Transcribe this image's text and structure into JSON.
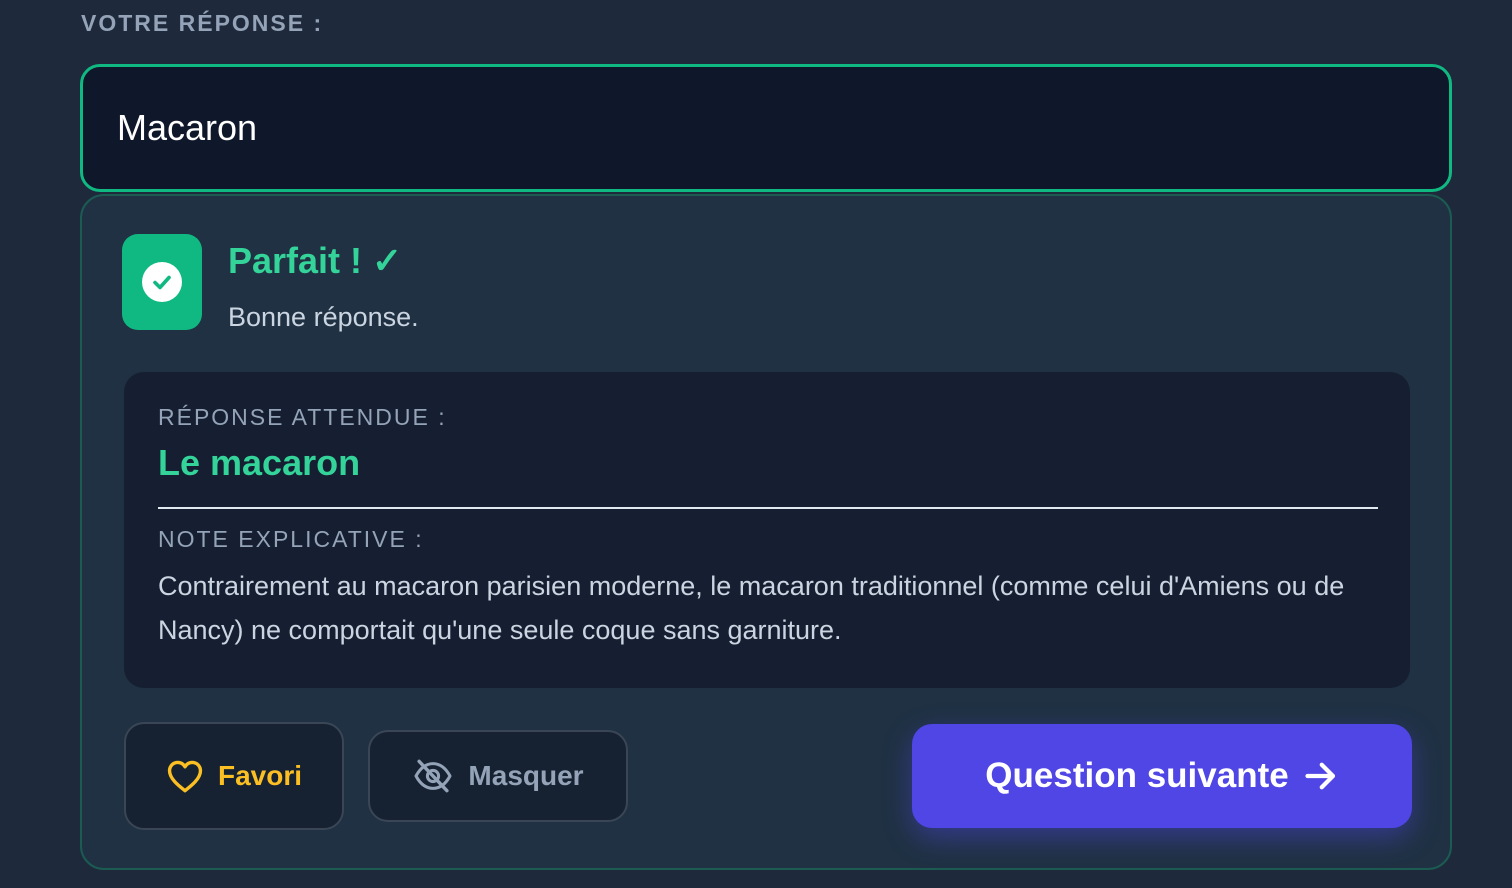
{
  "answer": {
    "label": "VOTRE RÉPONSE :",
    "value": "Macaron"
  },
  "feedback": {
    "title": "Parfait ! ✓",
    "subtitle": "Bonne réponse.",
    "status_color": "#10b981",
    "expected_label": "RÉPONSE ATTENDUE :",
    "expected_value": "Le macaron",
    "note_label": "NOTE EXPLICATIVE :",
    "note_text": "Contrairement au macaron parisien moderne, le macaron traditionnel (comme celui d'Amiens ou de Nancy) ne comportait qu'une seule coque sans garniture."
  },
  "actions": {
    "favorite_label": "Favori",
    "favorite_icon": "heart-icon",
    "hide_label": "Masquer",
    "hide_icon": "eye-off-icon",
    "next_label": "Question suivante",
    "next_icon": "arrow-right-icon",
    "next_color": "#4f46e5"
  }
}
